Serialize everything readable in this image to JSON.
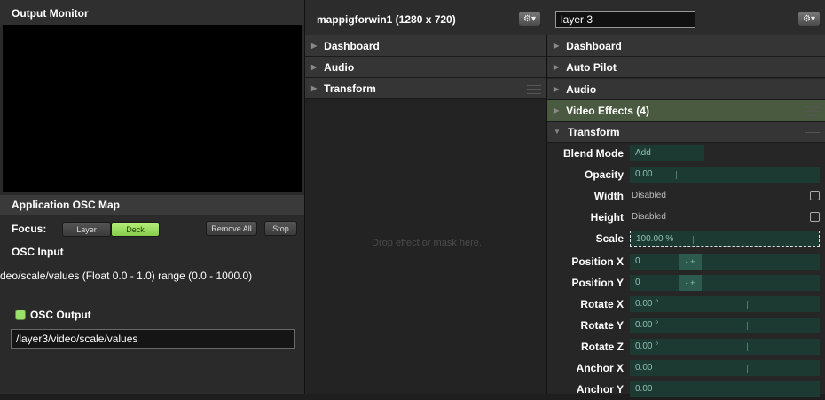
{
  "output_monitor": {
    "title": "Output Monitor"
  },
  "osc_map": {
    "title": "Application OSC Map",
    "focus_label": "Focus:",
    "focus_options": [
      "Layer",
      "Deck"
    ],
    "focus_selected": "Deck",
    "remove_all_label": "Remove All",
    "stop_label": "Stop",
    "osc_input_label": "OSC Input",
    "osc_input_text": "deo/scale/values (Float 0.0 - 1.0) range (0.0 - 1000.0)",
    "osc_output_label": "OSC Output",
    "osc_output_value": "/layer3/video/scale/values"
  },
  "composition": {
    "title": "mappigforwin1 (1280 x 720)",
    "gear_label": "⚙▾",
    "sections": [
      "Dashboard",
      "Audio",
      "Transform"
    ],
    "drop_hint": "Drop effect or mask here."
  },
  "layer": {
    "name": "layer 3",
    "gear_label": "⚙▾",
    "sections": [
      "Dashboard",
      "Auto Pilot",
      "Audio",
      "Video Effects (4)",
      "Transform"
    ],
    "properties": [
      {
        "label": "Blend Mode",
        "value": "Add"
      },
      {
        "label": "Opacity",
        "value": "0.00"
      },
      {
        "label": "Width",
        "value": "Disabled"
      },
      {
        "label": "Height",
        "value": "Disabled"
      },
      {
        "label": "Scale",
        "value": "100.00 %"
      },
      {
        "label": "Position X",
        "value": "0",
        "stepper": "- +"
      },
      {
        "label": "Position Y",
        "value": "0",
        "stepper": "- +"
      },
      {
        "label": "Rotate X",
        "value": "0.00 °"
      },
      {
        "label": "Rotate Y",
        "value": "0.00 °"
      },
      {
        "label": "Rotate Z",
        "value": "0.00 °"
      },
      {
        "label": "Anchor X",
        "value": "0.00"
      },
      {
        "label": "Anchor Y",
        "value": "0.00"
      }
    ]
  },
  "colors": {
    "accent_green": "#9be06a",
    "field_bg": "#1c3a32",
    "video_effects_bg": "#4a5a40"
  }
}
